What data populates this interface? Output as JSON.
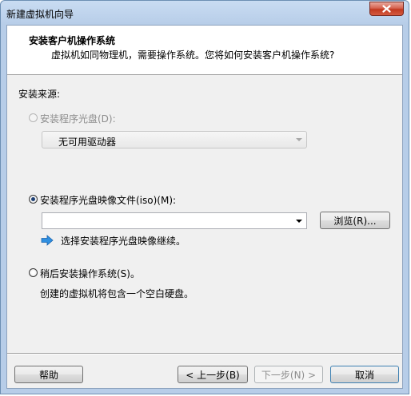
{
  "window": {
    "title": "新建虚拟机向导"
  },
  "header": {
    "title": "安装客户机操作系统",
    "subtitle": "虚拟机如同物理机，需要操作系统。您将如何安装客户机操作系统?"
  },
  "install_source": {
    "label": "安装来源:",
    "options": {
      "disc": {
        "label": "安装程序光盘(D):",
        "selected": false,
        "enabled": false,
        "drive_combo_value": "无可用驱动器"
      },
      "iso": {
        "label": "安装程序光盘映像文件(iso)(M):",
        "selected": true,
        "enabled": true,
        "path_value": "",
        "browse_label": "浏览(R)...",
        "hint": "选择安装程序光盘映像继续。",
        "hint_icon": "blue-arrow-right-icon"
      },
      "later": {
        "label": "稍后安装操作系统(S)。",
        "selected": false,
        "enabled": true,
        "description": "创建的虚拟机将包含一个空白硬盘。"
      }
    }
  },
  "footer": {
    "help_label": "帮助",
    "back_label": "< 上一步(B)",
    "next_label": "下一步(N) >",
    "next_enabled": false,
    "cancel_label": "取消"
  },
  "colors": {
    "titlebar": "#b7cde8",
    "close_button": "#c2391f",
    "client_background": "#f0f0f0",
    "header_background": "#ffffff",
    "disabled_text": "#8d8d8d",
    "hint_arrow": "#2f8fe0"
  }
}
